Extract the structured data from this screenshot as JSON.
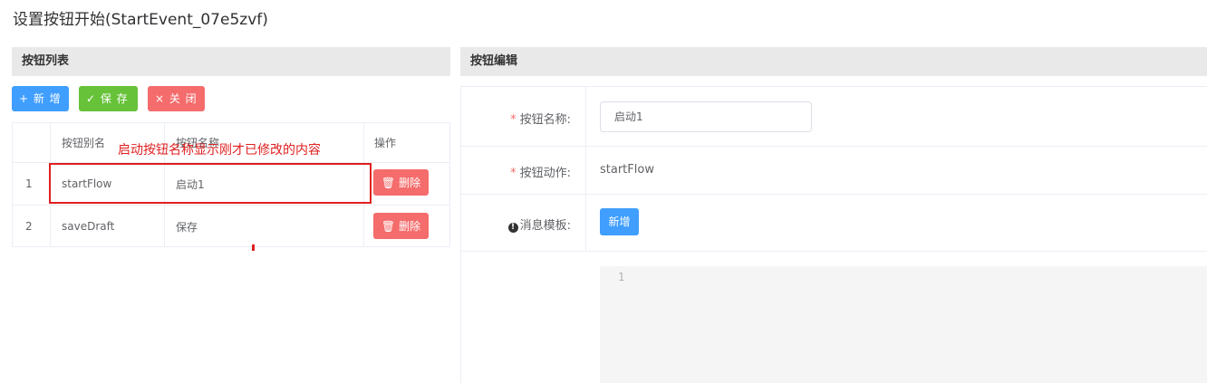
{
  "page": {
    "title": "设置按钮开始(StartEvent_07e5zvf)"
  },
  "left_panel": {
    "header": "按钮列表",
    "toolbar": {
      "add_label": "+ 新 增",
      "save_label": "✓ 保 存",
      "close_label": "× 关 闭"
    },
    "table": {
      "columns": [
        "",
        "按钮别名",
        "按钮名称",
        "操作"
      ],
      "rows": [
        {
          "index": "1",
          "alias": "startFlow",
          "name": "启动1",
          "delete_label": "删除"
        },
        {
          "index": "2",
          "alias": "saveDraft",
          "name": "保存",
          "delete_label": "删除"
        }
      ]
    }
  },
  "annotation": {
    "text": "启动按钮名称显示刚才已修改的内容",
    "color": "#e02020"
  },
  "right_panel": {
    "header": "按钮编辑",
    "form": {
      "name_label": "按钮名称:",
      "name_value": "启动1",
      "action_label": "按钮动作:",
      "action_value": "startFlow",
      "template_label": "消息模板:",
      "template_add_label": "新增",
      "required_mark": "*",
      "info_icon": "!"
    },
    "editor": {
      "line_number": "1"
    }
  },
  "colors": {
    "primary": "#409eff",
    "success": "#67c23a",
    "danger": "#f56c6c"
  }
}
